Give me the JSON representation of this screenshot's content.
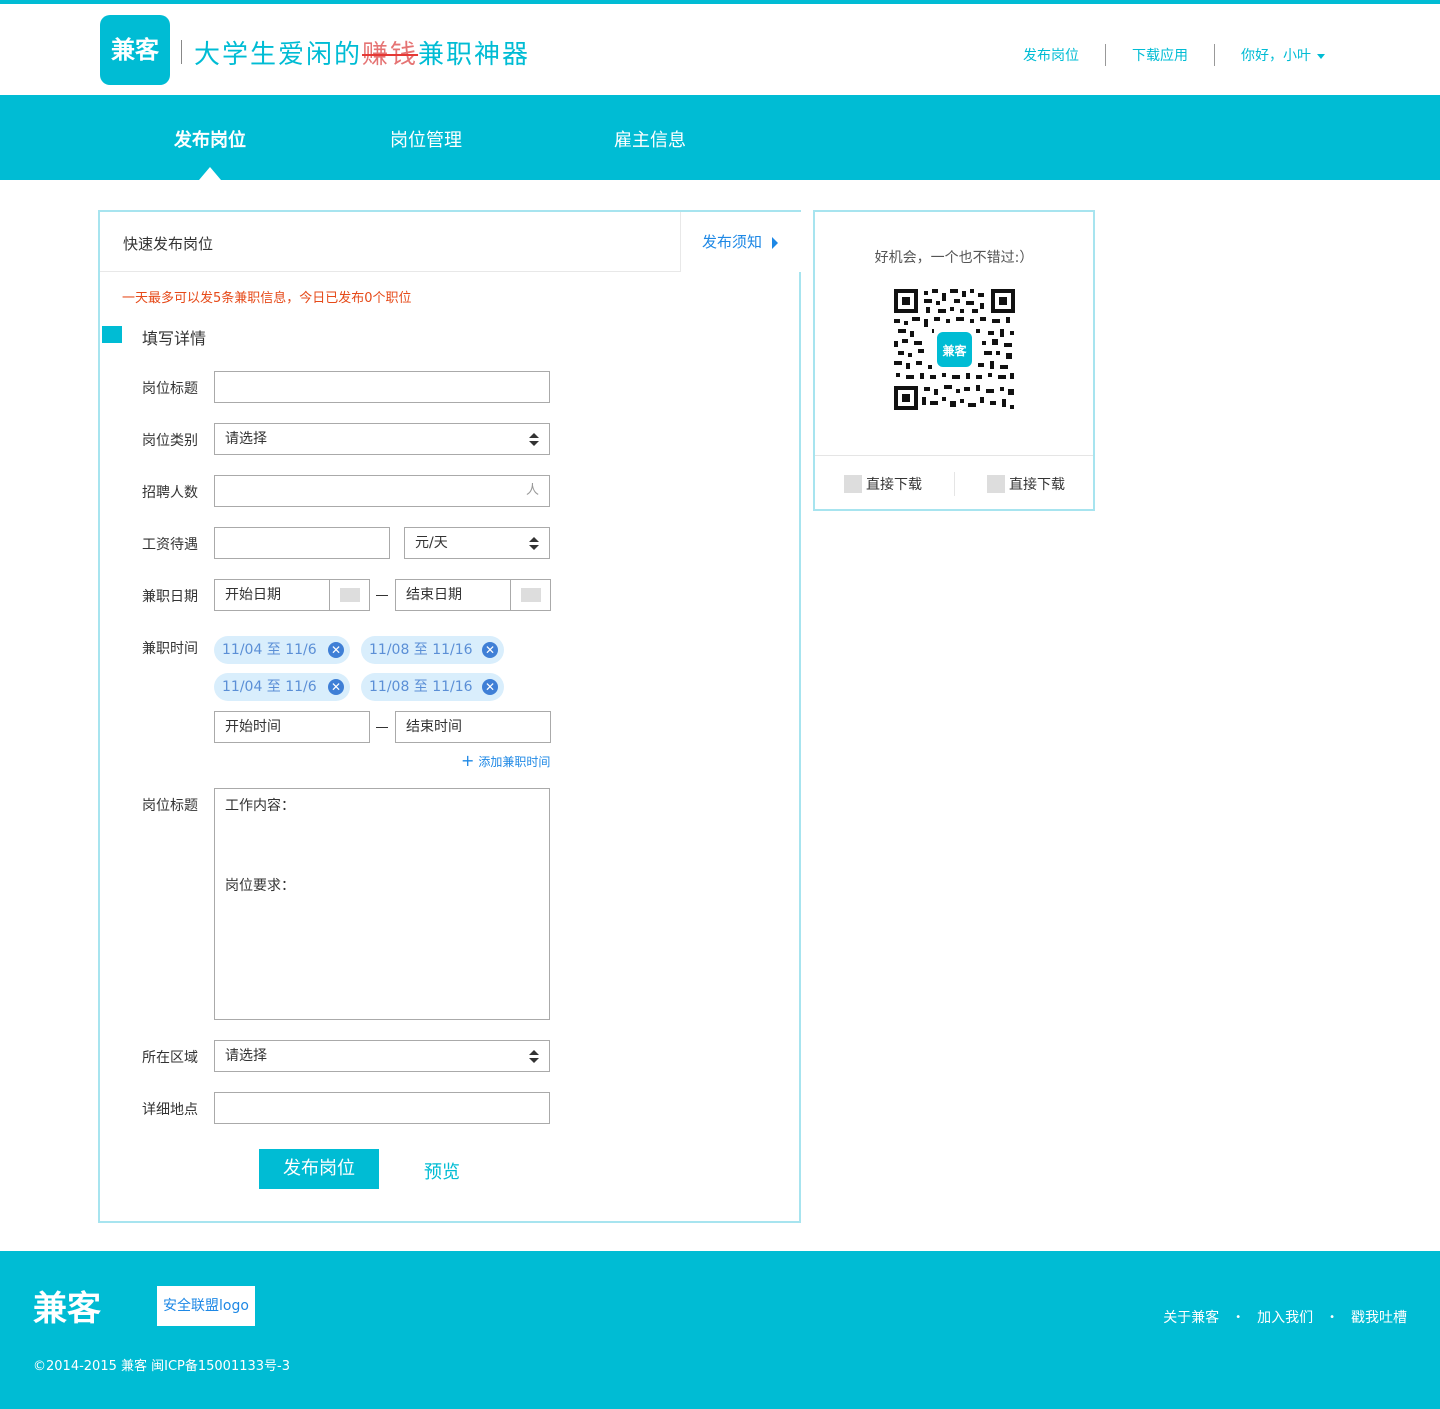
{
  "brand": {
    "name": "兼客",
    "slogan_a": "大学生爱闲的",
    "slogan_strike": "赚钱",
    "slogan_b": "兼职神器"
  },
  "topnav": {
    "post_job": "发布岗位",
    "download_app": "下载应用",
    "greeting": "你好，小叶"
  },
  "mainnav": {
    "items": [
      {
        "label": "发布岗位"
      },
      {
        "label": "岗位管理"
      },
      {
        "label": "雇主信息"
      }
    ]
  },
  "panel": {
    "title": "快速发布岗位",
    "notice": "发布须知",
    "limit_text": "一天最多可以发5条兼职信息，今日已发布0个职位",
    "section_title": "填写详情"
  },
  "form": {
    "job_title": {
      "label": "岗位标题",
      "value": ""
    },
    "job_category": {
      "label": "岗位类别",
      "value": "请选择"
    },
    "headcount": {
      "label": "招聘人数",
      "value": "",
      "unit": "人"
    },
    "salary": {
      "label": "工资待遇",
      "value": "",
      "unit_select": "元/天"
    },
    "dates": {
      "label": "兼职日期",
      "start": "开始日期",
      "end": "结束日期"
    },
    "times": {
      "label": "兼职时间",
      "tags": [
        "11/04 至 11/6",
        "11/08 至 11/16",
        "11/04 至 11/6",
        "11/08 至 11/16"
      ],
      "start": "开始时间",
      "end": "结束时间",
      "add": "添加兼职时间"
    },
    "description": {
      "label": "岗位标题",
      "line1": "工作内容：",
      "line2": "岗位要求："
    },
    "area": {
      "label": "所在区域",
      "value": "请选择"
    },
    "address": {
      "label": "详细地点",
      "value": ""
    },
    "submit": "发布岗位",
    "preview": "预览"
  },
  "side": {
    "caption": "好机会，一个也不错过:）",
    "qr_badge": "兼客",
    "download_a": "直接下载",
    "download_b": "直接下载"
  },
  "footer": {
    "logo": "兼客",
    "badge": "安全联盟logo",
    "copyright": "©2014-2015 兼客 闽ICP备15001133号-3",
    "links": [
      "关于兼客",
      "加入我们",
      "戳我吐槽"
    ]
  },
  "colors": {
    "primary": "#00bcd4",
    "link": "#1e88e5",
    "warning": "#e64a19",
    "tag_bg": "#d9eefc"
  }
}
